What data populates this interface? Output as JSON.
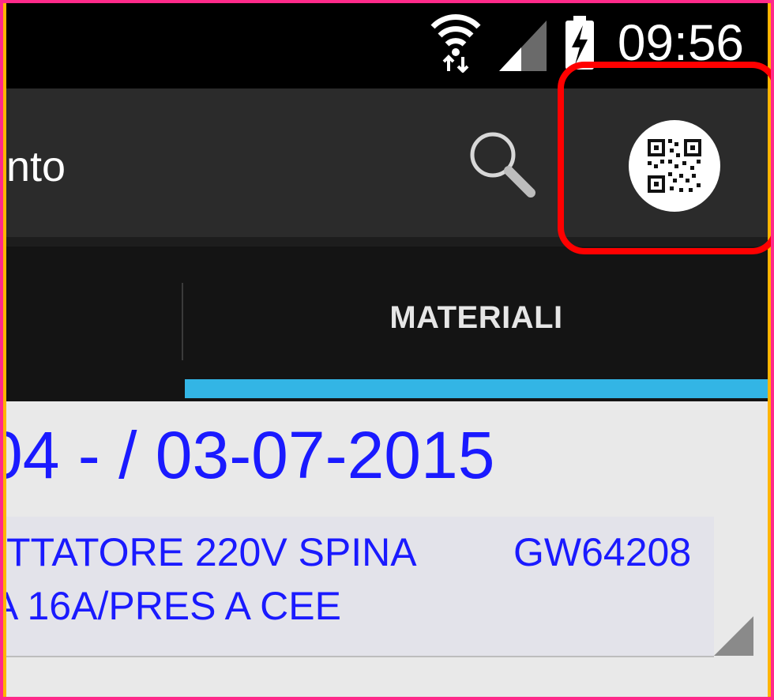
{
  "status_bar": {
    "time": "09:56",
    "icons": [
      "wifi-icon",
      "signal-icon",
      "battery-charging-icon"
    ]
  },
  "action_bar": {
    "title": "nto",
    "search_icon": "search-icon",
    "qr_icon": "qr-code-icon"
  },
  "tabs": {
    "active_label": "MATERIALI"
  },
  "content": {
    "title": "04 -  / 03-07-2015",
    "item": {
      "description_line1": "TTATORE 220V SPINA",
      "description_line2": "A 16A/PRES A CEE",
      "code": "GW64208"
    }
  },
  "colors": {
    "accent": "#33b5e5",
    "text_blue": "#1a1aff",
    "highlight": "#ff0000",
    "frame_pink": "#ff2a8a",
    "frame_orange": "#ffb400"
  }
}
